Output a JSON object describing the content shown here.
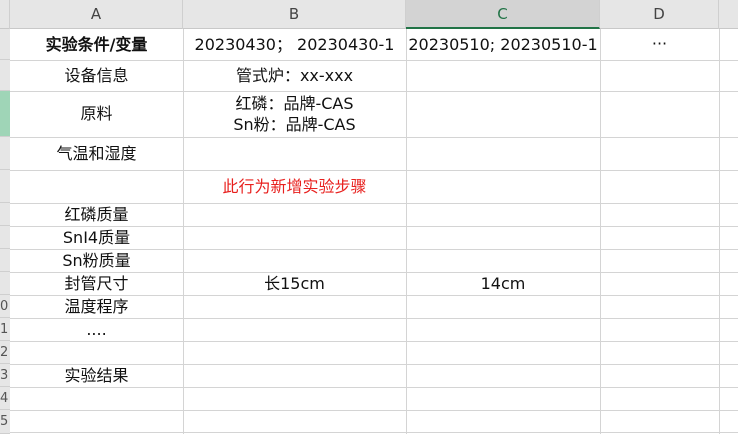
{
  "columns": [
    "A",
    "B",
    "C",
    "D"
  ],
  "row_numbers": [
    "",
    "",
    "",
    "",
    "",
    "",
    "",
    "",
    "",
    "0",
    "1",
    "2",
    "3",
    "4",
    "5"
  ],
  "cells": {
    "a1": "实验条件/变量",
    "b1": "20230430； 20230430-1",
    "c1": "20230510; 20230510-1",
    "d1": "···",
    "a2": "设备信息",
    "b2": "管式炉：xx-xxx",
    "a3": "原料",
    "b3_line1": "红磷：品牌-CAS",
    "b3_line2": "Sn粉：品牌-CAS",
    "a4": "气温和湿度",
    "b5": "此行为新增实验步骤",
    "a6": "红磷质量",
    "a7": "SnI4质量",
    "a8": "Sn粉质量",
    "a9": "封管尺寸",
    "b9": "长15cm",
    "c9": "14cm",
    "a10": "温度程序",
    "a11": "....",
    "a13": "实验结果"
  },
  "colors": {
    "selected_header": "#217346",
    "selected_row": "#9fd5b7",
    "highlight_text": "#e8201e"
  }
}
